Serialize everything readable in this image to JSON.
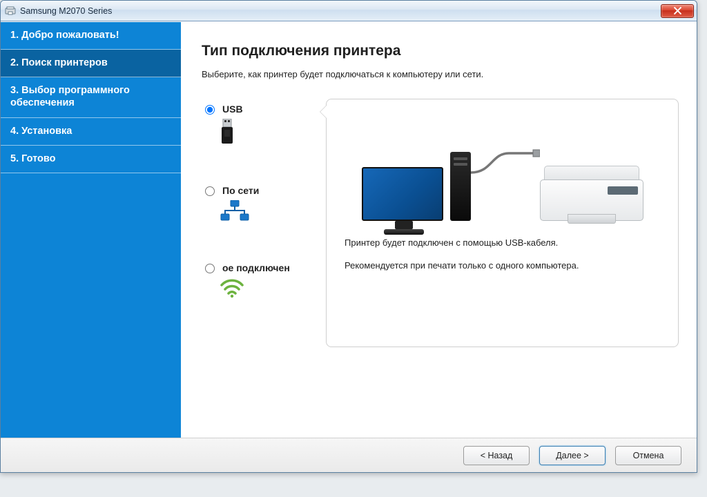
{
  "window": {
    "title": "Samsung M2070 Series"
  },
  "sidebar": {
    "steps": [
      {
        "label": "1. Добро пожаловать!"
      },
      {
        "label": "2. Поиск принтеров"
      },
      {
        "label": "3. Выбор программного обеспечения"
      },
      {
        "label": "4. Установка"
      },
      {
        "label": "5. Готово"
      }
    ],
    "active_index": 1
  },
  "main": {
    "heading": "Тип подключения принтера",
    "subtitle": "Выберите, как принтер будет подключаться к компьютеру или сети."
  },
  "options": {
    "usb": {
      "label": "USB",
      "selected": true
    },
    "network": {
      "label": "По сети",
      "selected": false
    },
    "wireless": {
      "label": "ое подключен",
      "selected": false
    }
  },
  "preview": {
    "line1": "Принтер будет подключен с помощью USB-кабеля.",
    "line2": "Рекомендуется при печати только с одного компьютера."
  },
  "footer": {
    "back": "< Назад",
    "next": "Далее >",
    "cancel": "Отмена"
  }
}
